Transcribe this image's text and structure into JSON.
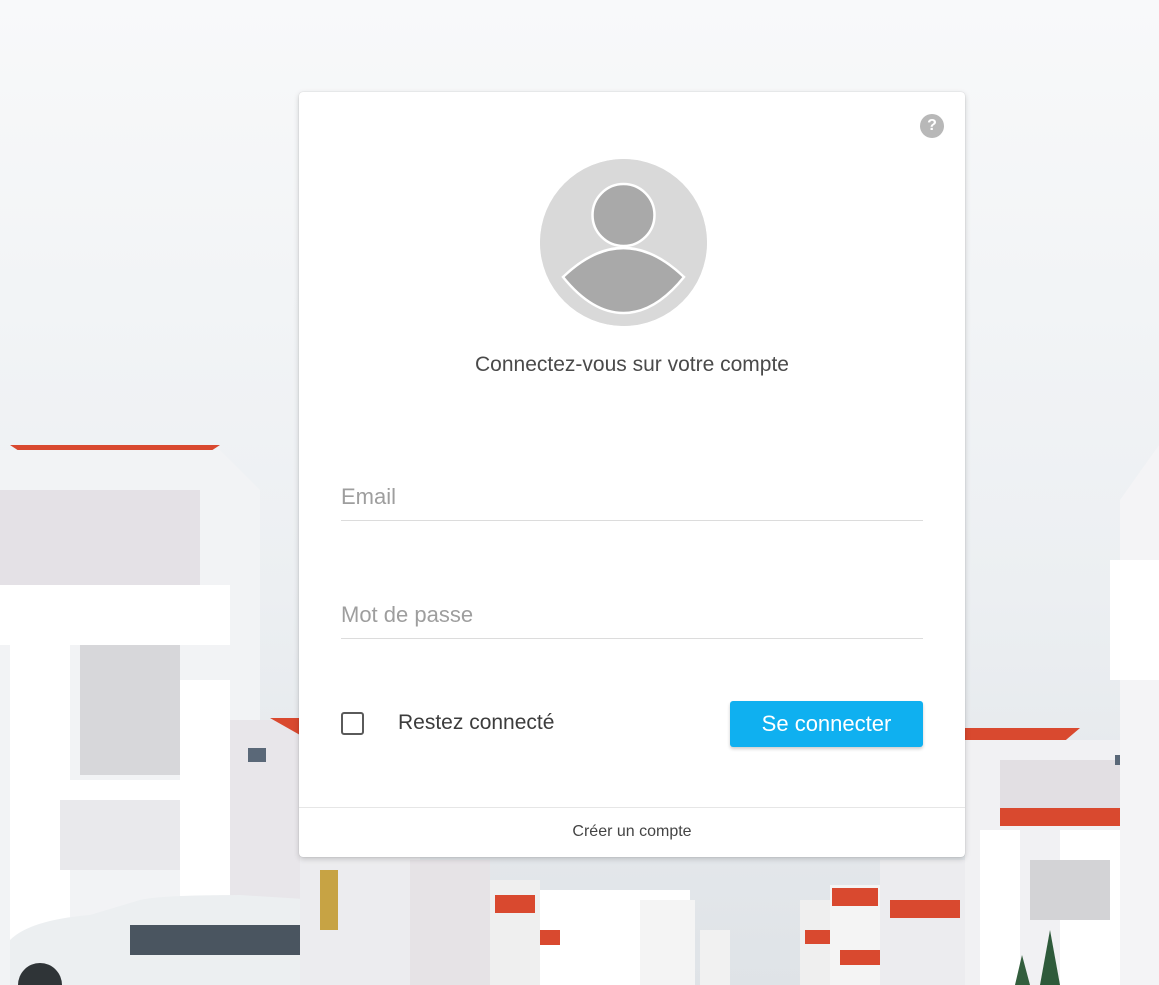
{
  "login": {
    "title": "Connectez-vous sur votre compte",
    "email_placeholder": "Email",
    "email_value": "",
    "password_placeholder": "Mot de passe",
    "password_value": "",
    "remember_label": "Restez connecté",
    "remember_checked": false,
    "submit_label": "Se connecter",
    "create_account_label": "Créer un compte",
    "help_icon": "question-circle-icon",
    "avatar_icon": "default-user-avatar-icon"
  },
  "colors": {
    "accent": "#0fb0f0",
    "card": "#ffffff",
    "avatar_bg": "#d9d9d9",
    "avatar_figure": "#a9a9a9",
    "roof": "#d9492f"
  }
}
